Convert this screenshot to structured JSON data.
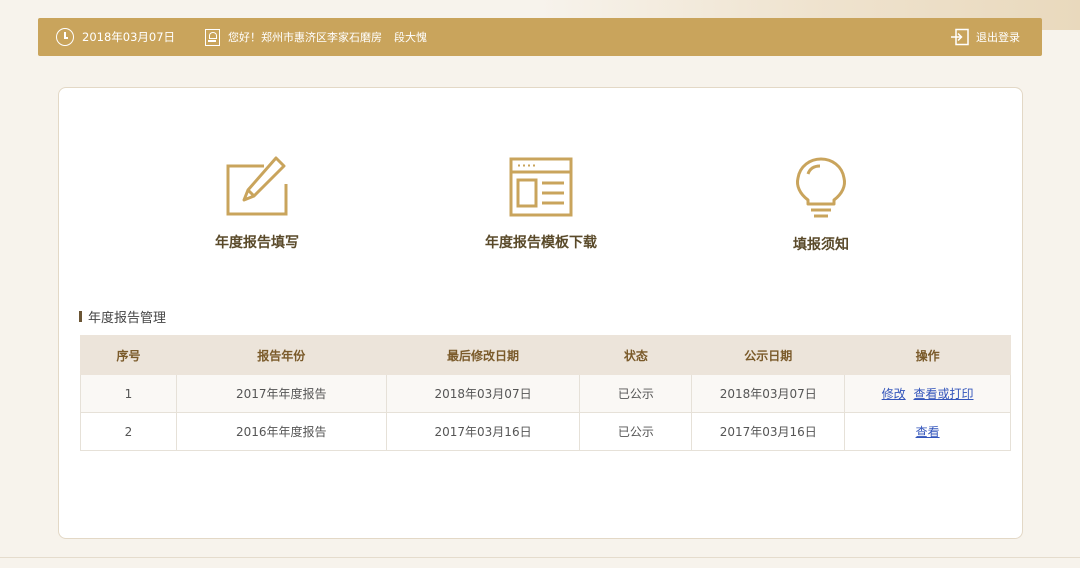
{
  "topbar": {
    "date": "2018年03月07日",
    "greeting": "您好！郑州市惠济区李家石磨房",
    "username": "段大愧",
    "logout_label": "退出登录"
  },
  "features": [
    {
      "label": "年度报告填写",
      "icon": "edit-icon"
    },
    {
      "label": "年度报告模板下载",
      "icon": "template-icon"
    },
    {
      "label": "填报须知",
      "icon": "lightbulb-icon"
    }
  ],
  "section": {
    "title": "年度报告管理"
  },
  "table": {
    "headers": [
      "序号",
      "报告年份",
      "最后修改日期",
      "状态",
      "公示日期",
      "操作"
    ],
    "rows": [
      {
        "index": "1",
        "year": "2017年年度报告",
        "modified": "2018年03月07日",
        "status": "已公示",
        "published": "2018年03月07日",
        "actions": [
          "修改",
          "查看或打印"
        ]
      },
      {
        "index": "2",
        "year": "2016年年度报告",
        "modified": "2017年03月16日",
        "status": "已公示",
        "published": "2017年03月16日",
        "actions": [
          "查看"
        ]
      }
    ]
  },
  "colors": {
    "accent": "#c9a45c",
    "header_bg": "#ece4da",
    "link": "#3355bb"
  }
}
